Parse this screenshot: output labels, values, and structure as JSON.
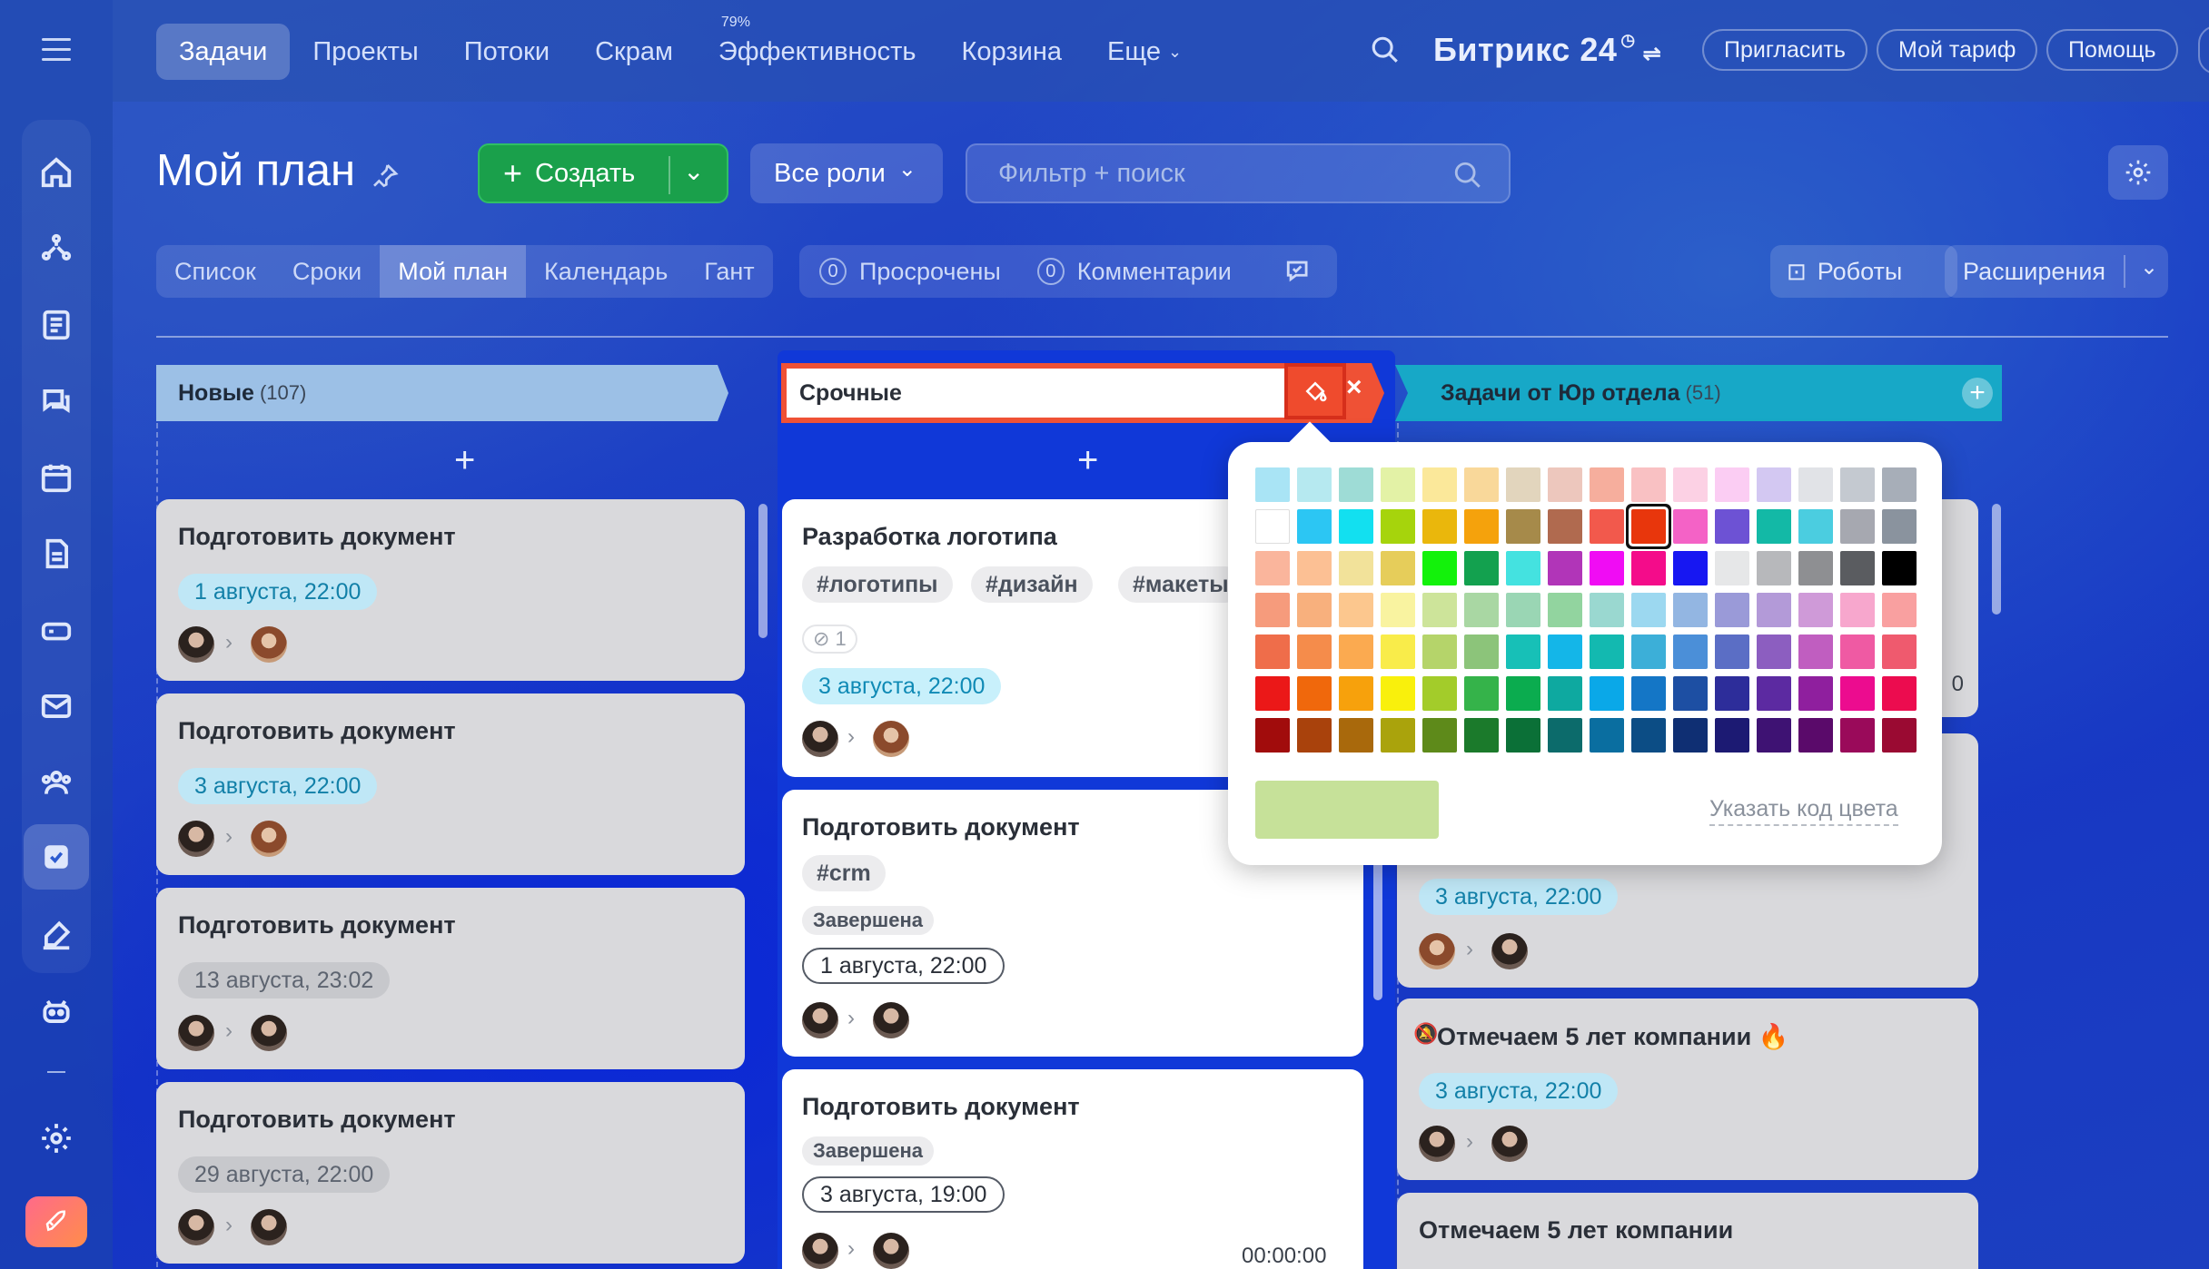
{
  "topnav": {
    "items": [
      "Задачи",
      "Проекты",
      "Потоки",
      "Скрам",
      "Эффективность",
      "Корзина",
      "Еще"
    ],
    "efficiency_badge": "79%",
    "brand": "Битрикс 24",
    "invite": "Пригласить",
    "tariff": "Мой тариф",
    "help": "Помощь"
  },
  "header": {
    "title": "Мой план",
    "create": "Создать",
    "roles": "Все роли",
    "search_placeholder": "Фильтр + поиск"
  },
  "views": [
    "Список",
    "Сроки",
    "Мой план",
    "Календарь",
    "Гант"
  ],
  "counters": {
    "overdue_count": "0",
    "overdue": "Просрочены",
    "comments_count": "0",
    "comments": "Комментарии"
  },
  "actions": {
    "robots": "Роботы",
    "extensions": "Расширения"
  },
  "columns": {
    "new": {
      "title": "Новые",
      "count": "(107)",
      "cards": [
        {
          "title": "Подготовить документ",
          "date": "1 августа, 22:00"
        },
        {
          "title": "Подготовить документ",
          "date": "3 августа, 22:00"
        },
        {
          "title": "Подготовить документ",
          "date": "13 августа, 23:02"
        },
        {
          "title": "Подготовить документ",
          "date": "29 августа, 22:00"
        }
      ]
    },
    "urgent": {
      "title_value": "Срочные",
      "cards": [
        {
          "title": "Разработка логотипа",
          "tags": [
            "#логотипы",
            "#дизайн",
            "#макеты"
          ],
          "attachments": "1",
          "date": "3 августа, 22:00"
        },
        {
          "title": "Подготовить документ",
          "tags": [
            "#crm"
          ],
          "status": "Завершена",
          "date": "1 августа, 22:00"
        },
        {
          "title": "Подготовить документ",
          "status": "Завершена",
          "date": "3 августа, 19:00",
          "timer": "00:00:00"
        }
      ]
    },
    "legal": {
      "title": "Задачи от Юр отдела",
      "count": "(51)",
      "cards": [
        {
          "date": "3 августа, 22:00"
        },
        {
          "title": "Отмечаем 5 лет компании",
          "date": "3 августа, 22:00"
        },
        {
          "title": "Отмечаем 5 лет компании"
        }
      ],
      "partial_digit": "0"
    }
  },
  "color_picker": {
    "selected_color": "#e8360c",
    "preview_color": "#c6e199",
    "custom_code_link": "Указать код цвета",
    "rows": [
      [
        "#a9e4f5",
        "#b6e9f0",
        "#9edcd6",
        "#e3f2a6",
        "#fbe89a",
        "#f9d89a",
        "#e2d5bd",
        "#edc7bd",
        "#f6ae9d",
        "#f9c1c3",
        "#fcd1e4",
        "#fbcdf3",
        "#d3c8f2",
        "#e1e3e7",
        "#c4c9d0",
        "#a7aeb8"
      ],
      [
        "#ffffff",
        "#2cc6f3",
        "#12e0f0",
        "#a6d40c",
        "#eab70c",
        "#f5a20c",
        "#a68a4a",
        "#b06a4f",
        "#f2594c",
        "#e8360c",
        "#f462c6",
        "#6d52d4",
        "#13b9a6",
        "#4bcde0",
        "#a6a8b0",
        "#8a939e"
      ],
      [
        "#fab59c",
        "#fcc094",
        "#f2e29a",
        "#e6cd5a",
        "#13f20b",
        "#13a14f",
        "#44e2e0",
        "#b135b8",
        "#f00cf4",
        "#f40c8a",
        "#1717f2",
        "#e6e7e8",
        "#b7b8bb",
        "#8e8f92",
        "#5a5c60",
        "#000000"
      ],
      [
        "#f69b7c",
        "#f8b07d",
        "#fcc78e",
        "#f9f3a0",
        "#cde49a",
        "#a9d7a3",
        "#9ad6b4",
        "#92d49f",
        "#9ad8d0",
        "#9cd8f0",
        "#93b6e2",
        "#9a9ad8",
        "#b39ad8",
        "#cf9ad8",
        "#f7a7cd",
        "#f9a0a0"
      ],
      [
        "#ef6d4a",
        "#f58c4b",
        "#fbaa50",
        "#f9ec4a",
        "#b5d46a",
        "#8cc47a",
        "#17c0b7",
        "#14b6e8",
        "#13b9b0",
        "#3cafd8",
        "#4b8fd8",
        "#5b6ec5",
        "#8c5ec0",
        "#c05ec0",
        "#ef5aa3",
        "#ef5a6e"
      ],
      [
        "#eb1818",
        "#f0680c",
        "#f7a10c",
        "#f9f00c",
        "#a3cc2a",
        "#35b34a",
        "#0bac4f",
        "#0ea9a0",
        "#0aa8e8",
        "#1476c6",
        "#1d4fa3",
        "#2d2d9a",
        "#5c2aa1",
        "#8f1f9e",
        "#ec0c8f",
        "#ec0c4f"
      ],
      [
        "#a10c0c",
        "#a9420c",
        "#a9690c",
        "#aaa30c",
        "#5e8a1a",
        "#1b7a2b",
        "#0b7037",
        "#0c6b6b",
        "#0a6ea0",
        "#0c4d85",
        "#0f2f73",
        "#1c1a73",
        "#3e1273",
        "#5a0a6a",
        "#9a0a5a",
        "#9a0a32"
      ]
    ]
  }
}
